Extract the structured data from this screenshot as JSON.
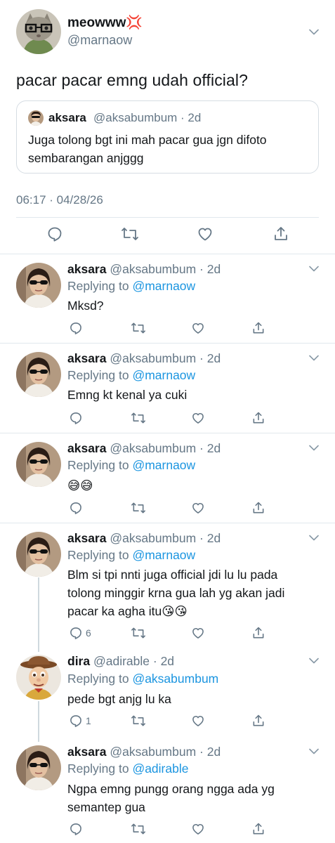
{
  "main": {
    "author_name": "meowww💢",
    "author_handle": "@marnaow",
    "text": "pacar pacar emng udah official?",
    "quote": {
      "name": "aksara",
      "handle_time": "@aksabumbum · 2d",
      "text": "Juga tolong bgt ini mah pacar gua jgn difoto sembarangan anjggg"
    },
    "timestamp": "06:17 · 04/28/26"
  },
  "replies": [
    {
      "name": "aksara",
      "handle_time": "@aksabumbum · 2d",
      "replying_label": "Replying to",
      "replying_to": "@marnaow",
      "text": "Mksd?",
      "reply_count": ""
    },
    {
      "name": "aksara",
      "handle_time": "@aksabumbum · 2d",
      "replying_label": "Replying to",
      "replying_to": "@marnaow",
      "text": "Emng kt kenal ya cuki",
      "reply_count": ""
    },
    {
      "name": "aksara",
      "handle_time": "@aksabumbum · 2d",
      "replying_label": "Replying to",
      "replying_to": "@marnaow",
      "text": "😅😅",
      "reply_count": ""
    },
    {
      "name": "aksara",
      "handle_time": "@aksabumbum · 2d",
      "replying_label": "Replying to",
      "replying_to": "@marnaow",
      "text": "Blm si tpi nnti juga official jdi lu lu pada tolong minggir krna gua lah yg akan jadi pacar ka agha itu😘😘",
      "reply_count": "6"
    },
    {
      "name": "dira",
      "handle_time": "@adirable · 2d",
      "replying_label": "Replying to",
      "replying_to": "@aksabumbum",
      "text": "pede bgt anjg lu ka",
      "reply_count": "1"
    },
    {
      "name": "aksara",
      "handle_time": "@aksabumbum · 2d",
      "replying_label": "Replying to",
      "replying_to": "@adirable",
      "text": "Ngpa emng pungg orang ngga ada yg semantep gua",
      "reply_count": ""
    }
  ],
  "icons": {
    "reply": "reply-icon",
    "retweet": "retweet-icon",
    "like": "heart-icon",
    "share": "share-icon",
    "more": "chevron-down-icon"
  },
  "colors": {
    "text": "#14171a",
    "secondary": "#657786",
    "link": "#1b95e0",
    "divider": "#e1e8ed"
  }
}
